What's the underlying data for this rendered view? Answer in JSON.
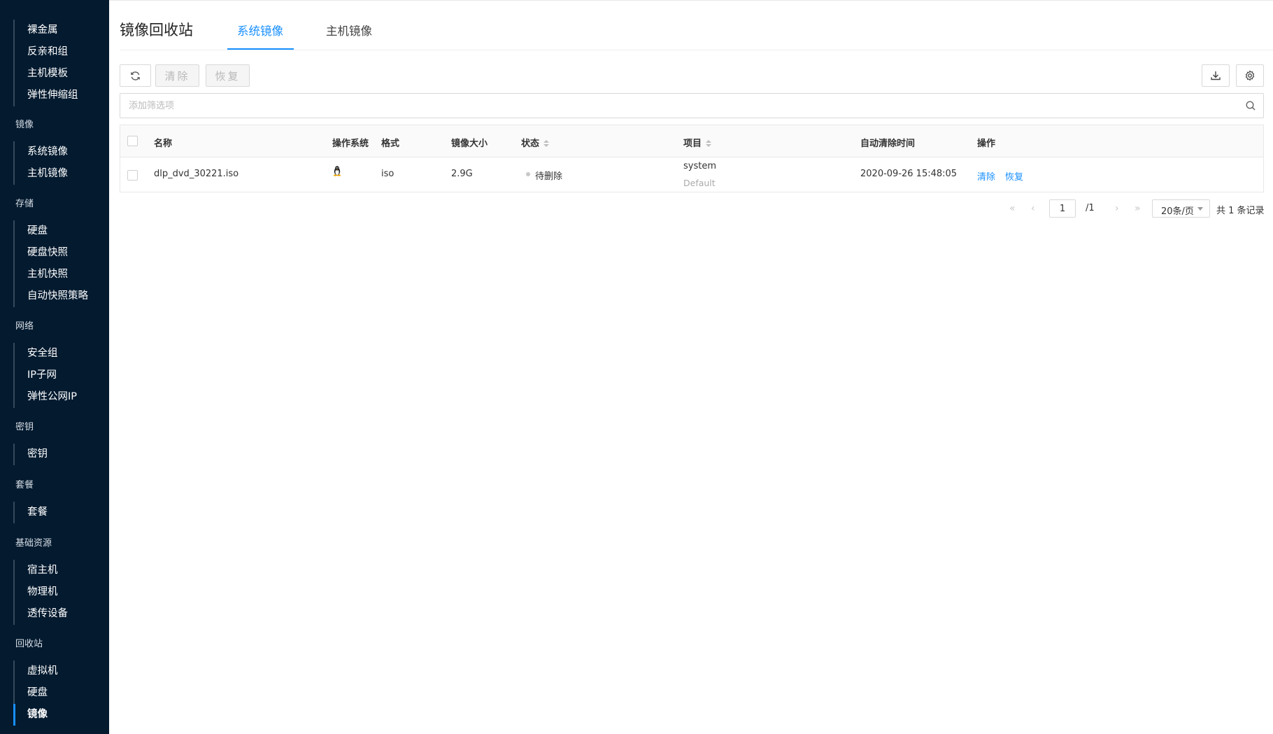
{
  "sidebar": {
    "groups": [
      {
        "title": "",
        "items": [
          {
            "label": "裸金属"
          },
          {
            "label": "反亲和组"
          },
          {
            "label": "主机模板"
          },
          {
            "label": "弹性伸缩组"
          }
        ]
      },
      {
        "title": "镜像",
        "items": [
          {
            "label": "系统镜像"
          },
          {
            "label": "主机镜像"
          }
        ]
      },
      {
        "title": "存储",
        "items": [
          {
            "label": "硬盘"
          },
          {
            "label": "硬盘快照"
          },
          {
            "label": "主机快照"
          },
          {
            "label": "自动快照策略"
          }
        ]
      },
      {
        "title": "网络",
        "items": [
          {
            "label": "安全组"
          },
          {
            "label": "IP子网"
          },
          {
            "label": "弹性公网IP"
          }
        ]
      },
      {
        "title": "密钥",
        "items": [
          {
            "label": "密钥"
          }
        ]
      },
      {
        "title": "套餐",
        "items": [
          {
            "label": "套餐"
          }
        ]
      },
      {
        "title": "基础资源",
        "items": [
          {
            "label": "宿主机"
          },
          {
            "label": "物理机"
          },
          {
            "label": "透传设备"
          }
        ]
      },
      {
        "title": "回收站",
        "items": [
          {
            "label": "虚拟机"
          },
          {
            "label": "硬盘"
          },
          {
            "label": "镜像"
          }
        ]
      }
    ],
    "active_item": "镜像"
  },
  "header": {
    "title": "镜像回收站",
    "tabs": [
      {
        "label": "系统镜像"
      },
      {
        "label": "主机镜像"
      }
    ],
    "active_tab": "系统镜像"
  },
  "toolbar": {
    "refresh_icon": "refresh-icon",
    "clear_label": "清除",
    "restore_label": "恢复",
    "export_icon": "download-icon",
    "settings_icon": "gear-icon"
  },
  "search": {
    "placeholder": "添加筛选项",
    "value": "",
    "icon": "search-icon"
  },
  "table": {
    "columns": {
      "name": "名称",
      "os": "操作系统",
      "format": "格式",
      "size": "镜像大小",
      "status": "状态",
      "project": "项目",
      "auto_clean_time": "自动清除时间",
      "actions": "操作"
    },
    "rows": [
      {
        "name": "dlp_dvd_30221.iso",
        "os_icon": "linux-penguin-icon",
        "format": "iso",
        "size": "2.9G",
        "status": "待删除",
        "project": "system",
        "project_domain": "Default",
        "auto_clean_time": "2020-09-26 15:48:05",
        "actions": {
          "clear": "清除",
          "restore": "恢复"
        }
      }
    ]
  },
  "pagination": {
    "current_page": "1",
    "total_pages": "/1",
    "page_size": "20条/页",
    "total": "共 1 条记录"
  },
  "colors": {
    "sidebar_bg": "#031a2f",
    "accent": "#1890ff",
    "status_dot": "#c8c8c8"
  }
}
